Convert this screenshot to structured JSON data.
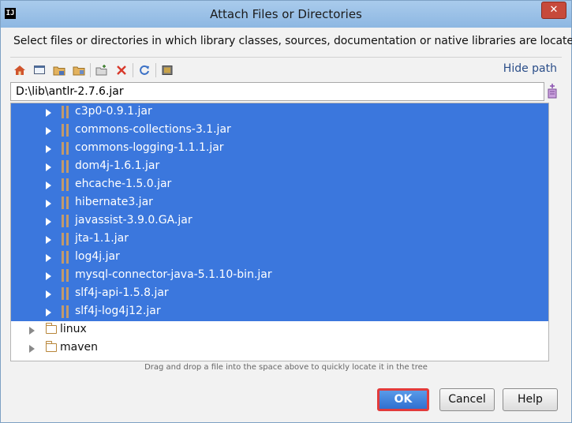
{
  "window": {
    "title": "Attach Files or Directories",
    "app_icon_text": "IJ",
    "close_glyph": "✕"
  },
  "description": "Select files or directories in which library classes, sources, documentation or native libraries are located",
  "toolbar": {
    "icons": [
      "home-icon",
      "desktop-icon",
      "project-folder-icon",
      "module-folder-icon",
      "new-folder-icon",
      "delete-icon",
      "refresh-icon",
      "show-hidden-icon"
    ],
    "hide_path_label": "Hide path"
  },
  "path": {
    "value": "D:\\lib\\antlr-2.7.6.jar"
  },
  "tree": {
    "selected_color": "#3b77dd",
    "items": [
      {
        "label": "c3p0-0.9.1.jar",
        "type": "jar",
        "selected": true
      },
      {
        "label": "commons-collections-3.1.jar",
        "type": "jar",
        "selected": true
      },
      {
        "label": "commons-logging-1.1.1.jar",
        "type": "jar",
        "selected": true
      },
      {
        "label": "dom4j-1.6.1.jar",
        "type": "jar",
        "selected": true
      },
      {
        "label": "ehcache-1.5.0.jar",
        "type": "jar",
        "selected": true
      },
      {
        "label": "hibernate3.jar",
        "type": "jar",
        "selected": true
      },
      {
        "label": "javassist-3.9.0.GA.jar",
        "type": "jar",
        "selected": true
      },
      {
        "label": "jta-1.1.jar",
        "type": "jar",
        "selected": true
      },
      {
        "label": "log4j.jar",
        "type": "jar",
        "selected": true
      },
      {
        "label": "mysql-connector-java-5.1.10-bin.jar",
        "type": "jar",
        "selected": true
      },
      {
        "label": "slf4j-api-1.5.8.jar",
        "type": "jar",
        "selected": true
      },
      {
        "label": "slf4j-log4j12.jar",
        "type": "jar",
        "selected": true
      },
      {
        "label": "linux",
        "type": "folder",
        "selected": false
      },
      {
        "label": "maven",
        "type": "folder",
        "selected": false
      }
    ]
  },
  "hint": "Drag and drop a file into the space above to quickly locate it in the tree",
  "buttons": {
    "ok": "OK",
    "cancel": "Cancel",
    "help": "Help"
  }
}
